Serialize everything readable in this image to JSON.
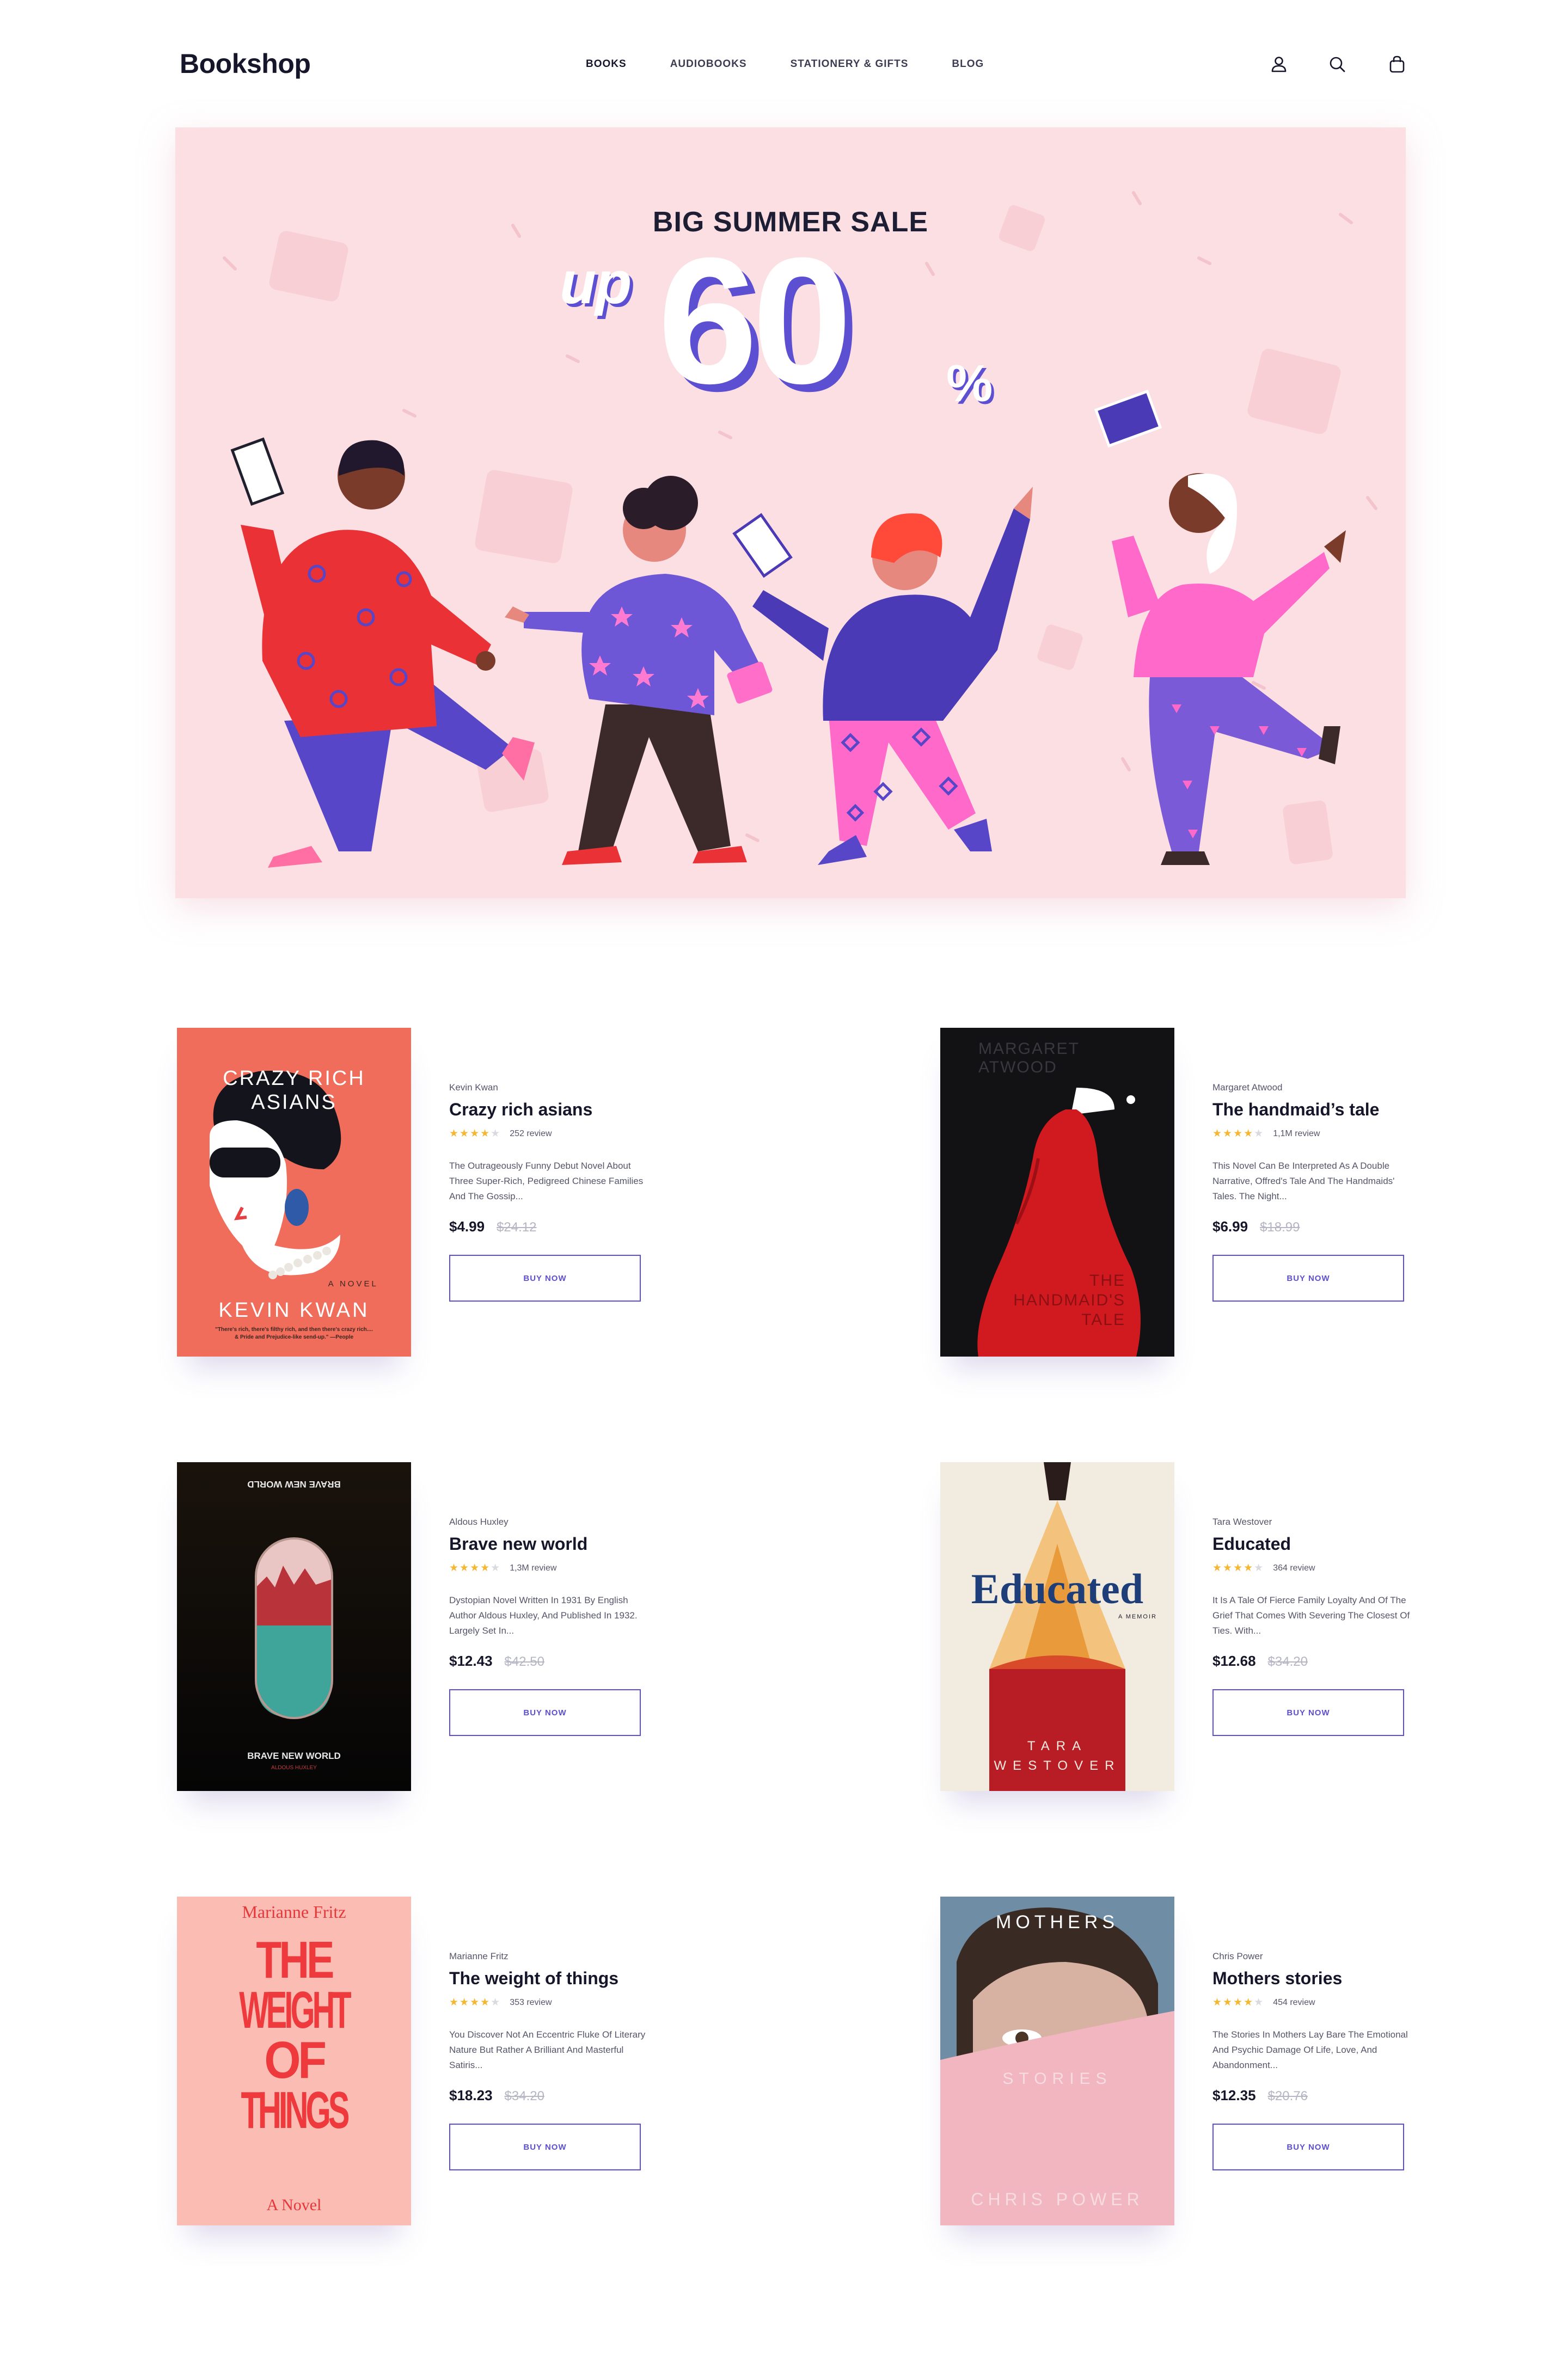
{
  "header": {
    "logo": "Bookshop",
    "nav": [
      "BOOKS",
      "AUDIOBOOKS",
      "STATIONERY & GIFTS",
      "BLOG"
    ],
    "icons": [
      "user-icon",
      "search-icon",
      "bag-icon"
    ]
  },
  "hero": {
    "title": "BIG SUMMER SALE",
    "up": "up",
    "number": "60",
    "percent": "%",
    "accent_color": "#5c4fd1",
    "background_color": "#fbdfe3"
  },
  "products": [
    {
      "author": "Kevin Kwan",
      "title": "Crazy rich asians",
      "rating": 4,
      "reviews": "252 review",
      "description": "The Outrageously Funny Debut Novel About Three Super-Rich, Pedigreed Chinese Families And The Gossip...",
      "price": "$4.99",
      "old_price": "$24.12",
      "button": "BUY NOW",
      "cover": {
        "line1": "CRAZY RICH",
        "line2": "ASIANS",
        "subtitle": "A NOVEL",
        "author": "KEVIN KWAN",
        "quote": "\"There's rich, there's filthy rich, and then there's crazy rich....\n& Pride and Prejudice-like send-up.\" —People"
      }
    },
    {
      "author": "Margaret Atwood",
      "title": "The handmaid’s tale",
      "rating": 4,
      "reviews": "1,1M review",
      "description": "This Novel Can Be Interpreted As A Double Narrative, Offred's Tale And The Handmaids' Tales. The Night...",
      "price": "$6.99",
      "old_price": "$18.99",
      "button": "BUY NOW",
      "cover": {
        "author1": "MARGARET",
        "author2": "ATWOOD",
        "title1": "THE",
        "title2": "HANDMAID'S",
        "title3": "TALE"
      }
    },
    {
      "author": "Aldous Huxley",
      "title": "Brave new world",
      "rating": 4,
      "reviews": "1,3M review",
      "description": "Dystopian Novel Written In 1931 By English Author Aldous Huxley, And Published In 1932. Largely Set In...",
      "price": "$12.43",
      "old_price": "$42.50",
      "button": "BUY NOW",
      "cover": {
        "title": "BRAVE NEW WORLD",
        "author": "ALDOUS HUXLEY"
      }
    },
    {
      "author": "Tara Westover",
      "title": "Educated",
      "rating": 4,
      "reviews": "364 review",
      "description": "It Is A Tale Of Fierce Family Loyalty And Of The Grief That Comes With Severing The Closest Of Ties. With...",
      "price": "$12.68",
      "old_price": "$34.20",
      "button": "BUY NOW",
      "cover": {
        "title": "Educated",
        "subtitle": "A MEMOIR",
        "author1": "TARA",
        "author2": "WESTOVER"
      }
    },
    {
      "author": "Marianne Fritz",
      "title": "The weight of things",
      "rating": 4,
      "reviews": "353 review",
      "description": "You Discover Not An Eccentric Fluke Of Literary Nature But Rather A Brilliant And Masterful Satiris...",
      "price": "$18.23",
      "old_price": "$34.20",
      "button": "BUY NOW",
      "cover": {
        "author": "Marianne Fritz",
        "line1": "THE",
        "line2": "WEIGHT",
        "line3": "OF",
        "line4": "THINGS",
        "subtitle": "A Novel"
      }
    },
    {
      "author": "Chris Power",
      "title": "Mothers stories",
      "rating": 4,
      "reviews": "454 review",
      "description": "The Stories In Mothers Lay Bare The Emotional And Psychic Damage Of Life, Love, And Abandonment...",
      "price": "$12.35",
      "old_price": "$20.76",
      "button": "BUY NOW",
      "cover": {
        "title": "MOTHERS",
        "subtitle": "STORIES",
        "author": "CHRIS POWER"
      }
    }
  ]
}
